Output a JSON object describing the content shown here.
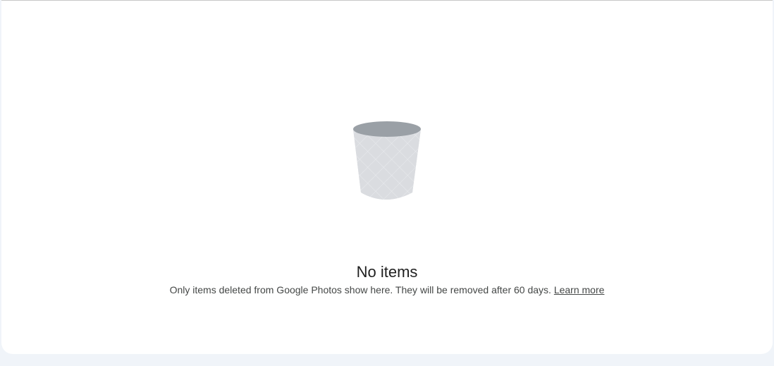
{
  "empty_state": {
    "illustration_icon": "trash-bin-icon",
    "title": "No items",
    "message": "Only items deleted from Google Photos show here. They will be removed after 60 days.",
    "link_label": "Learn more"
  },
  "colors": {
    "page_background": "#f0f4f9",
    "panel_background": "#ffffff",
    "bin_body": "#dadce0",
    "bin_rim": "#9aa0a6",
    "title_text": "#1f1f1f",
    "body_text": "#444746"
  }
}
